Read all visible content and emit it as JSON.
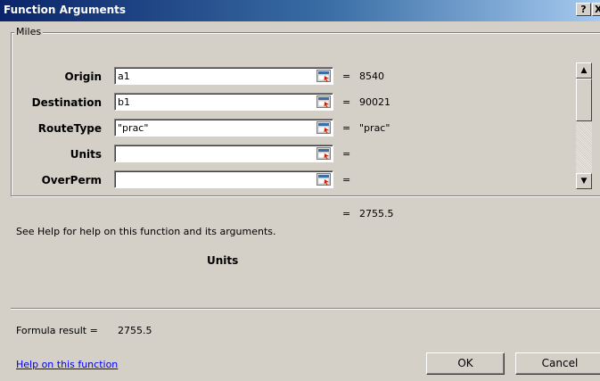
{
  "window": {
    "title": "Function Arguments",
    "help_glyph": "?",
    "close_glyph": "X"
  },
  "group": {
    "label": "Miles"
  },
  "arguments": [
    {
      "name": "Origin",
      "value": "a1",
      "equals": "=",
      "result": "8540"
    },
    {
      "name": "Destination",
      "value": "b1",
      "equals": "=",
      "result": "90021"
    },
    {
      "name": "RouteType",
      "value": "\"prac\"",
      "equals": "=",
      "result": "\"prac\""
    },
    {
      "name": "Units",
      "value": "",
      "equals": "=",
      "result": ""
    },
    {
      "name": "OverPerm",
      "value": "",
      "equals": "=",
      "result": ""
    }
  ],
  "function_result": {
    "equals": "=",
    "value": "2755.5"
  },
  "help_text": "See Help for help on this function and its arguments.",
  "current_argument": "Units",
  "formula_result": {
    "label": "Formula result =",
    "value": "2755.5"
  },
  "help_link": "Help on this function",
  "buttons": {
    "ok": "OK",
    "cancel": "Cancel"
  },
  "scrollbar": {
    "up_glyph": "▲",
    "down_glyph": "▼"
  },
  "colors": {
    "title_start": "#0a246a",
    "title_end": "#a6caf0",
    "face": "#d4d0c8",
    "link": "#0000ee"
  },
  "icons": {
    "collapse": "collapse-dialog-icon"
  }
}
